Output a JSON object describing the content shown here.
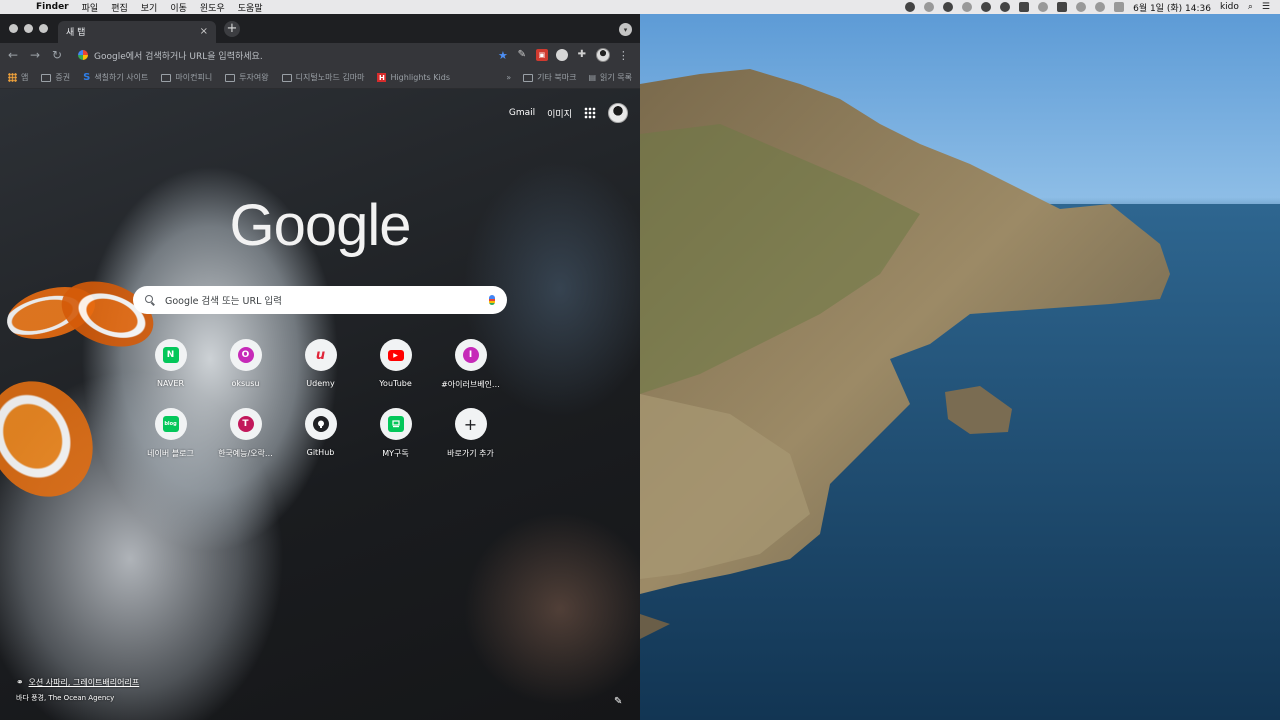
{
  "menubar": {
    "app": "Finder",
    "menus": [
      "파일",
      "편집",
      "보기",
      "이동",
      "윈도우",
      "도움말"
    ],
    "datetime": "6월 1일 (화) 14:36",
    "user": "kido"
  },
  "browser": {
    "tab_title": "새 탭",
    "tab_close": "×",
    "new_tab": "+",
    "omnibox_placeholder": "Google에서 검색하거나 URL을 입력하세요.",
    "bookmarks": [
      {
        "label": "앱",
        "icon": "apps-grid-icon"
      },
      {
        "label": "증권",
        "icon": "folder-icon"
      },
      {
        "label": "색칠하기 사이트",
        "icon": "s-logo-icon"
      },
      {
        "label": "마이컨피니",
        "icon": "folder-icon"
      },
      {
        "label": "투자여왕",
        "icon": "folder-icon"
      },
      {
        "label": "디지털노마드 김마마",
        "icon": "folder-icon"
      },
      {
        "label": "Highlights Kids",
        "icon": "highlights-logo-icon"
      }
    ],
    "bookmarks_more": "»",
    "bookmarks_other": "기타 북마크",
    "reading_list": "읽기 목록"
  },
  "ntp": {
    "gmail": "Gmail",
    "images": "이미지",
    "logo": "Google",
    "search_placeholder": "Google 검색 또는 URL 입력",
    "shortcuts": [
      {
        "label": "NAVER",
        "glyph": "N",
        "color": "#03c75a"
      },
      {
        "label": "oksusu",
        "glyph": "O",
        "color": "#c62ab8"
      },
      {
        "label": "Udemy",
        "glyph": "u",
        "color": "#e0263a"
      },
      {
        "label": "YouTube",
        "glyph": "▶",
        "color": "#ff0000"
      },
      {
        "label": "#아이러브베인…",
        "glyph": "I",
        "color": "#c62ab8"
      },
      {
        "label": "네이버 블로그",
        "glyph": "blog",
        "color": "#03c75a"
      },
      {
        "label": "한국예능/오락…",
        "glyph": "T",
        "color": "#c2185b"
      },
      {
        "label": "GitHub",
        "glyph": "",
        "color": "#202124"
      },
      {
        "label": "MY구독",
        "glyph": "",
        "color": "#03c75a"
      },
      {
        "label": "바로가기 추가",
        "glyph": "+",
        "color": "#202124"
      }
    ],
    "attribution_title": "오션 사파리, 그레이트배리어리프",
    "attribution_credit": "바다 풍경, The Ocean Agency"
  }
}
